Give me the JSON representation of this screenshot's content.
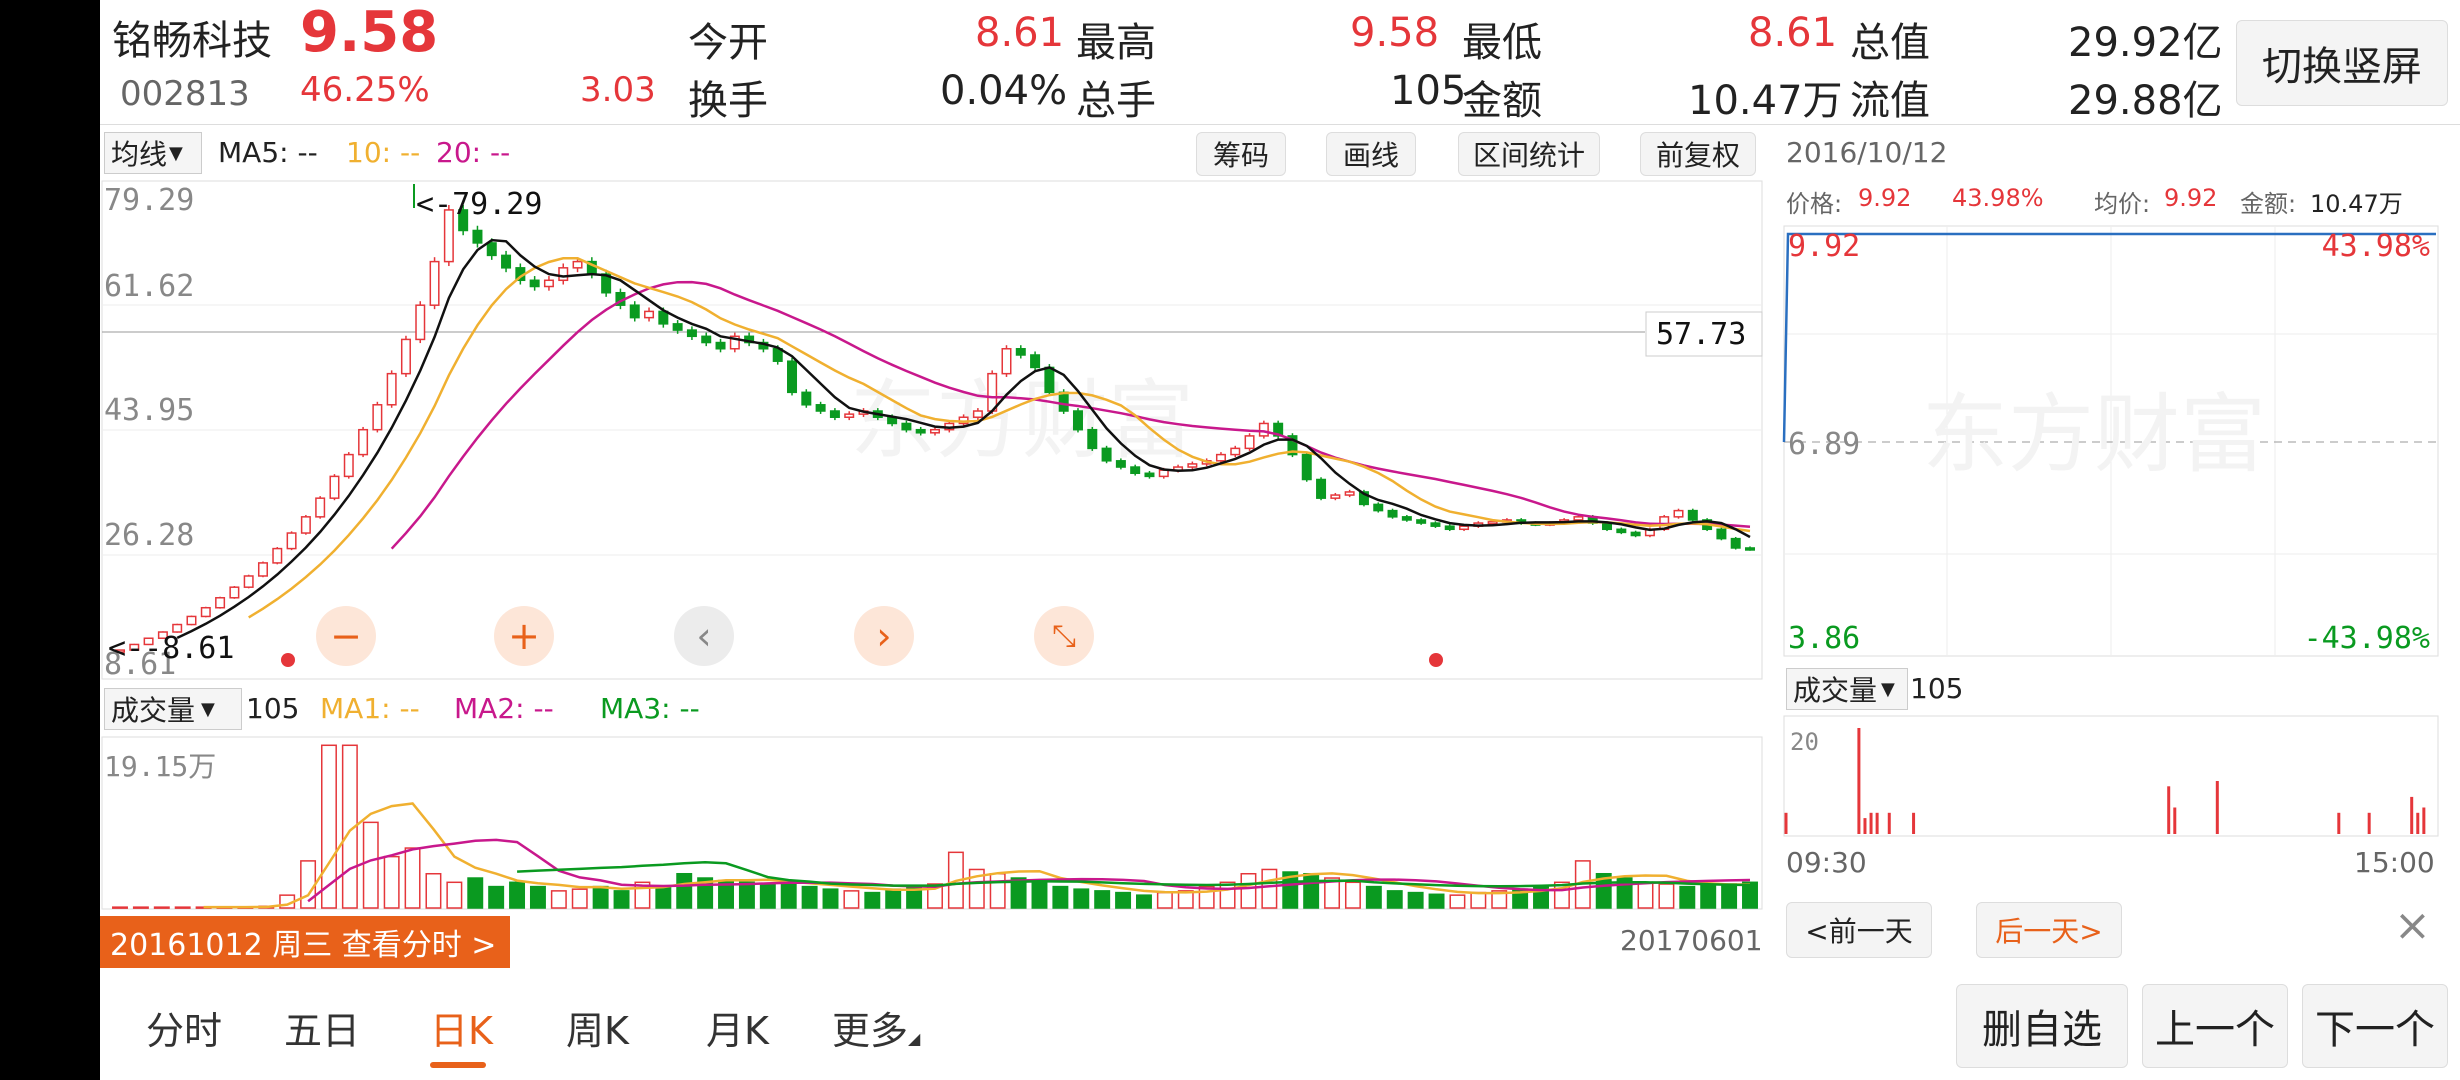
{
  "header": {
    "stock_name": "铭畅科技",
    "price": "9.58",
    "code": "002813",
    "change_pct": "46.25%",
    "change": "3.03",
    "open_label": "今开",
    "open_value": "8.61",
    "high_label": "最高",
    "high_value": "9.58",
    "low_label": "最低",
    "low_value": "8.61",
    "total_mv_label": "总值",
    "total_mv_value": "29.92亿",
    "turnover_label": "换手",
    "turnover_value": "0.04%",
    "total_vol_label": "总手",
    "total_vol_value": "105",
    "amount_label": "金额",
    "amount_value": "10.47万",
    "float_mv_label": "流值",
    "float_mv_value": "29.88亿",
    "switch_button": "切换竖屏"
  },
  "kline_toolbar": {
    "ma_select": "均线",
    "ma5": "MA5: --",
    "ma10": "10: --",
    "ma20": "20: --",
    "chips_button": "筹码",
    "draw_button": "画线",
    "range_stats_button": "区间统计",
    "adjust_button": "前复权"
  },
  "kline": {
    "y_labels": [
      "79.29",
      "61.62",
      "43.95",
      "26.28",
      "8.61"
    ],
    "max_marker": "<-79.29",
    "min_marker": "<--8.61",
    "price_line_label": "57.73",
    "watermark": "东方财富"
  },
  "volume_toolbar": {
    "select": "成交量",
    "value": "105",
    "ma1": "MA1: --",
    "ma2": "MA2: --",
    "ma3": "MA3: --",
    "y_label": "19.15万"
  },
  "date_bar": {
    "left_text": "20161012 周三 查看分时 >",
    "right_date": "20170601"
  },
  "intraday": {
    "date": "2016/10/12",
    "price_label": "价格:",
    "price": "9.92",
    "pct": "43.98%",
    "avg_label": "均价:",
    "avg": "9.92",
    "amount_label": "金额:",
    "amount": "10.47万",
    "top_left": "9.92",
    "top_right": "43.98%",
    "mid_label": "6.89",
    "bottom_left": "3.86",
    "bottom_right": "-43.98%",
    "watermark": "东方财富",
    "vol_select": "成交量",
    "vol_value": "105",
    "vol_y_label": "20",
    "time_start": "09:30",
    "time_end": "15:00",
    "prev_day": "<前一天",
    "next_day": "后一天>"
  },
  "tabs": [
    "分时",
    "五日",
    "日K",
    "周K",
    "月K",
    "更多"
  ],
  "active_tab": "日K",
  "bottom_buttons": {
    "remove": "删自选",
    "prev": "上一个",
    "next": "下一个"
  },
  "colors": {
    "up": "#e5363a",
    "down": "#0a9a20",
    "ma5": "#111111",
    "ma10": "#f0b030",
    "ma20": "#c8188c",
    "accent": "#e8611a"
  },
  "chart_data": [
    {
      "type": "candlestick",
      "series": [
        {
          "name": "MA5"
        },
        {
          "name": "10"
        },
        {
          "name": "20"
        }
      ],
      "ylim": [
        8.61,
        79.29
      ],
      "y_ticks": [
        79.29,
        61.62,
        43.95,
        26.28,
        8.61
      ],
      "x_range": [
        "20161012",
        "20170601"
      ],
      "values": [
        8.6,
        9.5,
        10.5,
        11.5,
        12.7,
        14,
        15.4,
        17,
        18.7,
        20.5,
        22.6,
        24.9,
        27.4,
        30,
        33,
        36.5,
        40,
        44,
        48,
        53,
        58.5,
        64,
        71,
        79.3,
        76,
        74,
        72,
        70,
        68,
        67,
        68,
        70,
        71,
        69,
        66,
        64,
        62,
        63,
        61,
        60,
        59,
        58,
        57,
        59,
        58,
        57,
        55,
        50,
        48,
        47,
        46,
        46.5,
        47,
        46,
        45,
        44,
        43.5,
        44,
        45,
        46,
        47,
        53,
        57,
        56,
        54,
        50,
        47,
        44,
        41,
        39,
        38,
        37,
        36.5,
        37.5,
        38,
        38.5,
        39,
        40,
        41,
        43,
        45,
        43,
        40,
        36,
        33,
        33.5,
        34,
        32,
        31,
        30,
        29.5,
        29,
        28.5,
        28,
        28.5,
        29,
        29.2,
        29.5,
        29,
        28.8,
        29,
        29.5,
        30,
        29,
        28,
        27.5,
        27,
        28,
        30,
        31,
        29.5,
        28,
        26.5,
        25,
        24.8
      ]
    },
    {
      "type": "bar",
      "title": "成交量",
      "ylim": [
        0,
        19.15
      ],
      "y_unit": "万",
      "values": [
        0.1,
        0.1,
        0.1,
        0.1,
        0.1,
        0.1,
        0.1,
        0.2,
        1.5,
        5.5,
        19,
        19,
        10,
        6,
        7,
        4,
        3,
        3.5,
        2.5,
        3,
        2.5,
        2,
        2.2,
        2.5,
        2,
        3,
        2.5,
        4,
        3.5,
        3.2,
        3,
        2.8,
        3,
        2.5,
        2.2,
        2,
        1.8,
        2.2,
        2.5,
        2.8,
        6.5,
        4.5,
        4,
        3.5,
        3,
        2.5,
        2.2,
        2,
        1.8,
        1.5,
        1.8,
        2,
        2.5,
        3,
        4,
        4.5,
        4.2,
        4,
        3.5,
        3,
        2.5,
        2,
        1.8,
        1.6,
        1.5,
        1.8,
        2,
        2.2,
        2.5,
        3,
        5.5,
        4,
        3.5,
        3,
        2.8,
        2.5,
        2.6,
        2.8,
        3
      ]
    },
    {
      "type": "line",
      "title": "分时",
      "ylim": [
        3.86,
        9.92
      ],
      "x_range": [
        "09:30",
        "15:00"
      ],
      "values": [
        6.89,
        9.92,
        9.92,
        9.92,
        9.92,
        9.92
      ]
    },
    {
      "type": "bar",
      "title": "分时成交量",
      "ylim": [
        0,
        20
      ],
      "values": [
        4,
        0,
        0,
        0,
        0,
        0,
        0,
        0,
        0,
        0,
        0,
        0,
        20,
        3,
        4,
        4,
        0,
        4,
        0,
        0,
        0,
        4,
        0,
        0,
        0,
        0,
        0,
        0,
        0,
        0,
        0,
        0,
        0,
        0,
        0,
        0,
        0,
        0,
        0,
        0,
        0,
        0,
        0,
        0,
        0,
        0,
        0,
        0,
        0,
        0,
        0,
        0,
        0,
        0,
        0,
        0,
        0,
        0,
        0,
        0,
        0,
        0,
        0,
        9,
        5,
        0,
        0,
        0,
        0,
        0,
        0,
        10,
        0,
        0,
        0,
        0,
        0,
        0,
        0,
        0,
        0,
        0,
        0,
        0,
        0,
        0,
        0,
        0,
        0,
        0,
        0,
        4,
        0,
        0,
        0,
        0,
        4,
        0,
        0,
        0,
        0,
        0,
        0,
        7,
        4,
        5,
        0,
        0
      ]
    }
  ]
}
